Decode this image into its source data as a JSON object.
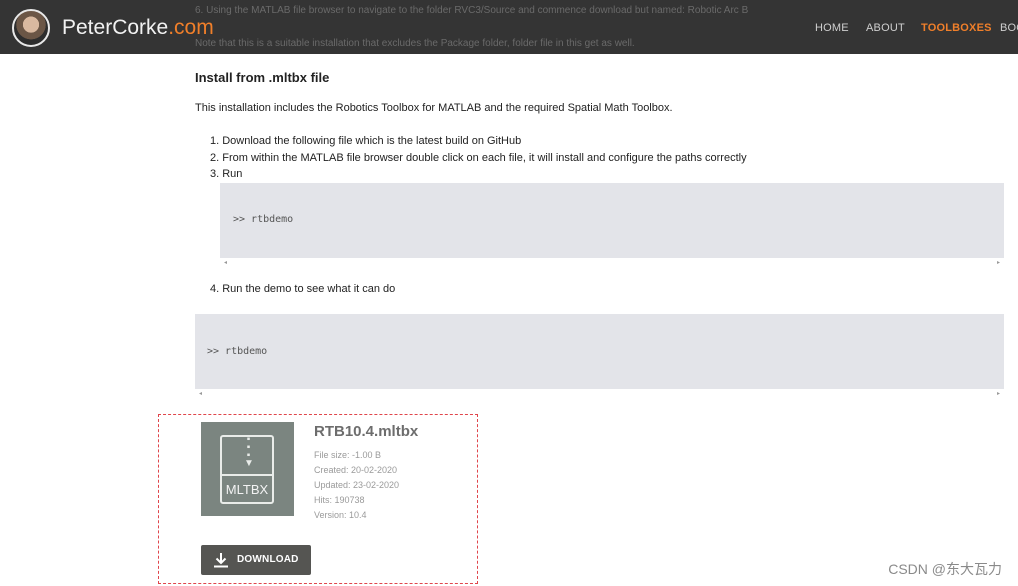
{
  "header": {
    "ghost_line_1": "6. Using the MATLAB file browser to navigate to the folder RVC3/Source and commence download but named: Robotic Arc B",
    "ghost_line_2": "Note that this is a suitable installation that excludes the Package folder, folder file in this get as well.",
    "logo_main": "PeterCorke",
    "logo_tld": ".com",
    "nav": [
      "HOME",
      "ABOUT",
      "TOOLBOXES",
      "BOO"
    ],
    "active_nav": "TOOLBOXES"
  },
  "content": {
    "heading": "Install from .mltbx file",
    "intro": "This installation includes the Robotics Toolbox for MATLAB and the required Spatial Math Toolbox.",
    "steps": [
      "1. Download the following file which is the latest build on GitHub",
      "2. From within the MATLAB file browser double click on each file, it will install and configure the paths correctly",
      "3. Run"
    ],
    "code_1": ">> rtbdemo",
    "step_4": "4. Run the demo to see what it can do",
    "code_2": ">> rtbdemo",
    "scroll_left": "◂",
    "scroll_right": "▸"
  },
  "download": {
    "icon_label": "MLTBX",
    "file_name": "RTB10.4.mltbx",
    "file_size": "File size: -1.00 B",
    "created": "Created: 20-02-2020",
    "updated": "Updated: 23-02-2020",
    "hits": "Hits: 190738",
    "version": "Version: 10.4",
    "button_label": "DOWNLOAD"
  },
  "watermark": "CSDN @东大瓦力",
  "colors": {
    "header_bg": "#343434",
    "accent_orange": "#f07f2a",
    "code_bg": "#e3e4e9",
    "highlight_border": "#e0454b",
    "button_bg": "#555552"
  }
}
